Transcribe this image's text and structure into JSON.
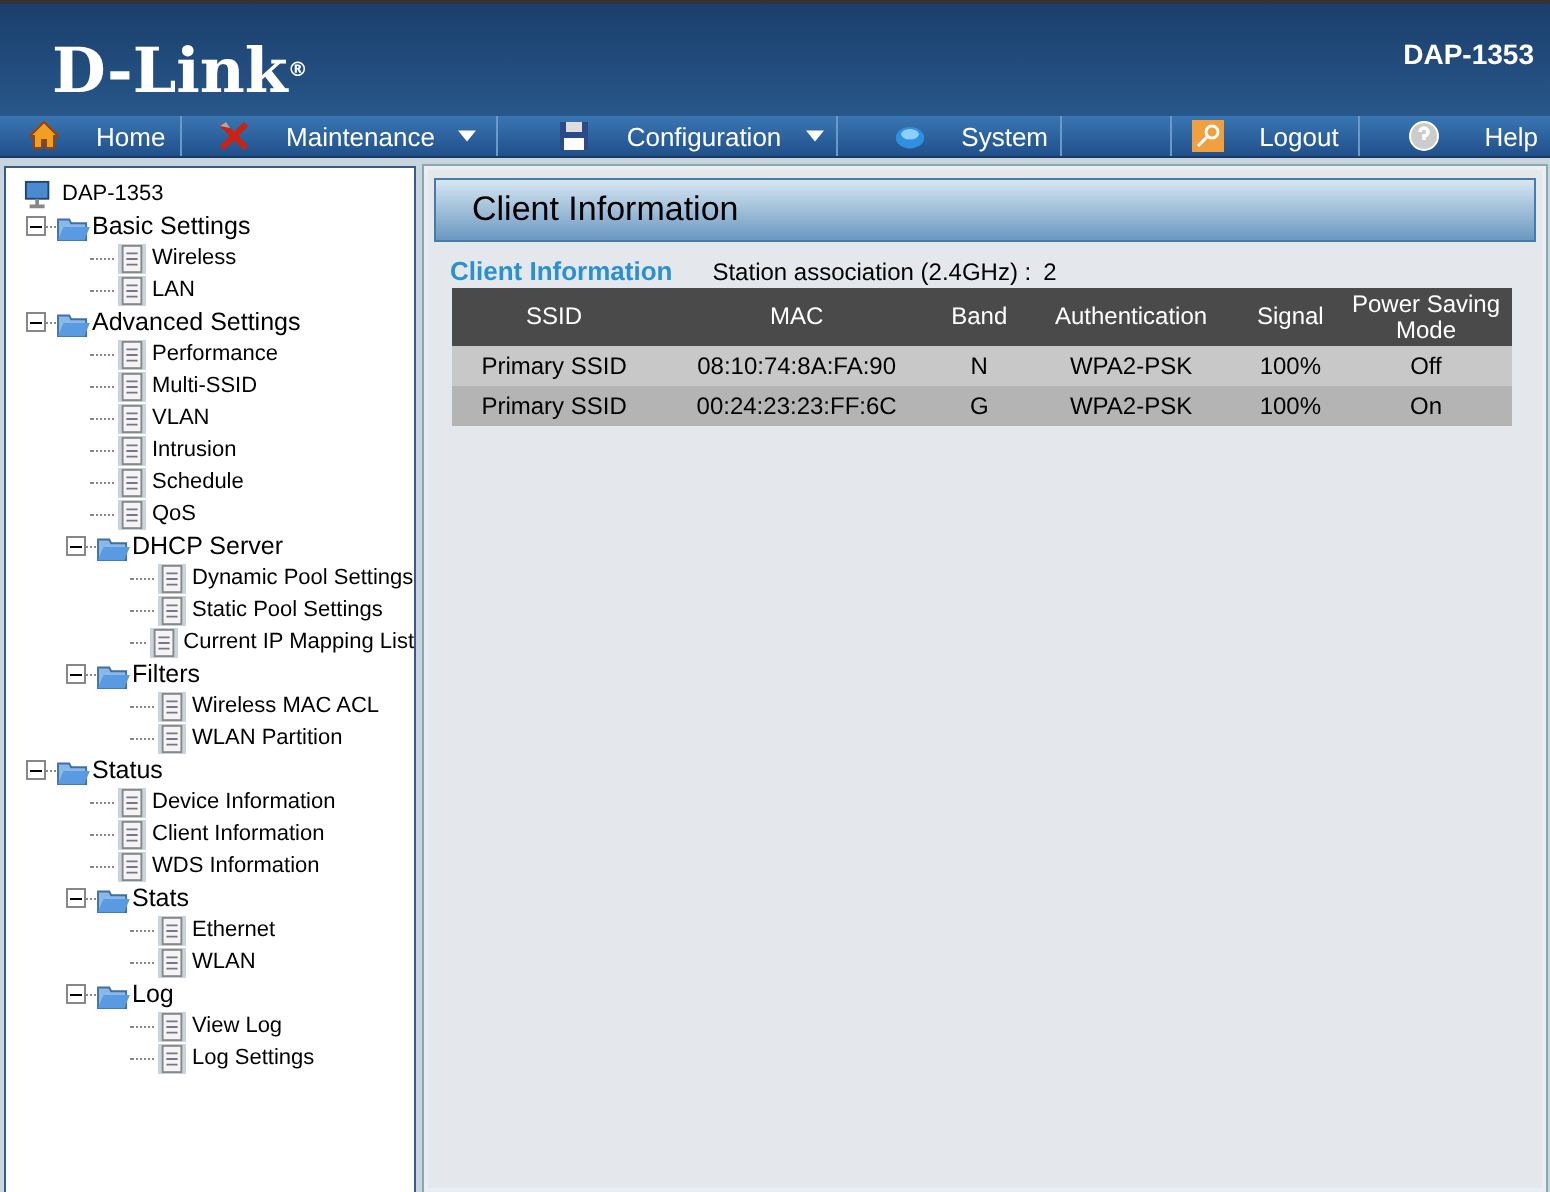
{
  "header": {
    "logo": "D-Link",
    "logo_mark": "®",
    "model": "DAP-1353"
  },
  "nav": [
    {
      "label": "Home",
      "dropdown": false
    },
    {
      "label": "Maintenance",
      "dropdown": true
    },
    {
      "label": "Configuration",
      "dropdown": true
    },
    {
      "label": "System",
      "dropdown": false
    },
    {
      "label": "Logout",
      "dropdown": false
    },
    {
      "label": "Help",
      "dropdown": false
    }
  ],
  "tree": {
    "label": "DAP-1353",
    "children": [
      {
        "label": "Basic Settings",
        "kind": "folder",
        "expanded": true,
        "children": [
          {
            "label": "Wireless",
            "kind": "page"
          },
          {
            "label": "LAN",
            "kind": "page"
          }
        ]
      },
      {
        "label": "Advanced Settings",
        "kind": "folder",
        "expanded": true,
        "children": [
          {
            "label": "Performance",
            "kind": "page"
          },
          {
            "label": "Multi-SSID",
            "kind": "page"
          },
          {
            "label": "VLAN",
            "kind": "page"
          },
          {
            "label": "Intrusion",
            "kind": "page"
          },
          {
            "label": "Schedule",
            "kind": "page"
          },
          {
            "label": "QoS",
            "kind": "page"
          },
          {
            "label": "DHCP Server",
            "kind": "folder",
            "expanded": true,
            "children": [
              {
                "label": "Dynamic Pool Settings",
                "kind": "page"
              },
              {
                "label": "Static Pool Settings",
                "kind": "page"
              },
              {
                "label": "Current IP Mapping List",
                "kind": "page"
              }
            ]
          },
          {
            "label": "Filters",
            "kind": "folder",
            "expanded": true,
            "children": [
              {
                "label": "Wireless MAC ACL",
                "kind": "page"
              },
              {
                "label": "WLAN Partition",
                "kind": "page"
              }
            ]
          }
        ]
      },
      {
        "label": "Status",
        "kind": "folder",
        "expanded": true,
        "children": [
          {
            "label": "Device Information",
            "kind": "page"
          },
          {
            "label": "Client Information",
            "kind": "page"
          },
          {
            "label": "WDS Information",
            "kind": "page"
          },
          {
            "label": "Stats",
            "kind": "folder",
            "expanded": true,
            "children": [
              {
                "label": "Ethernet",
                "kind": "page"
              },
              {
                "label": "WLAN",
                "kind": "page"
              }
            ]
          },
          {
            "label": "Log",
            "kind": "folder",
            "expanded": true,
            "children": [
              {
                "label": "View Log",
                "kind": "page"
              },
              {
                "label": "Log Settings",
                "kind": "page"
              }
            ]
          }
        ]
      }
    ]
  },
  "panel": {
    "title": "Client Information",
    "section": "Client Information",
    "station_label": "Station association (2.4GHz) :",
    "station_count": "2",
    "table": {
      "columns": [
        "SSID",
        "MAC",
        "Band",
        "Authentication",
        "Signal",
        "Power Saving Mode"
      ],
      "rows": [
        [
          "Primary SSID",
          "08:10:74:8A:FA:90",
          "N",
          "WPA2-PSK",
          "100%",
          "Off"
        ],
        [
          "Primary SSID",
          "00:24:23:23:FF:6C",
          "G",
          "WPA2-PSK",
          "100%",
          "On"
        ]
      ]
    }
  }
}
